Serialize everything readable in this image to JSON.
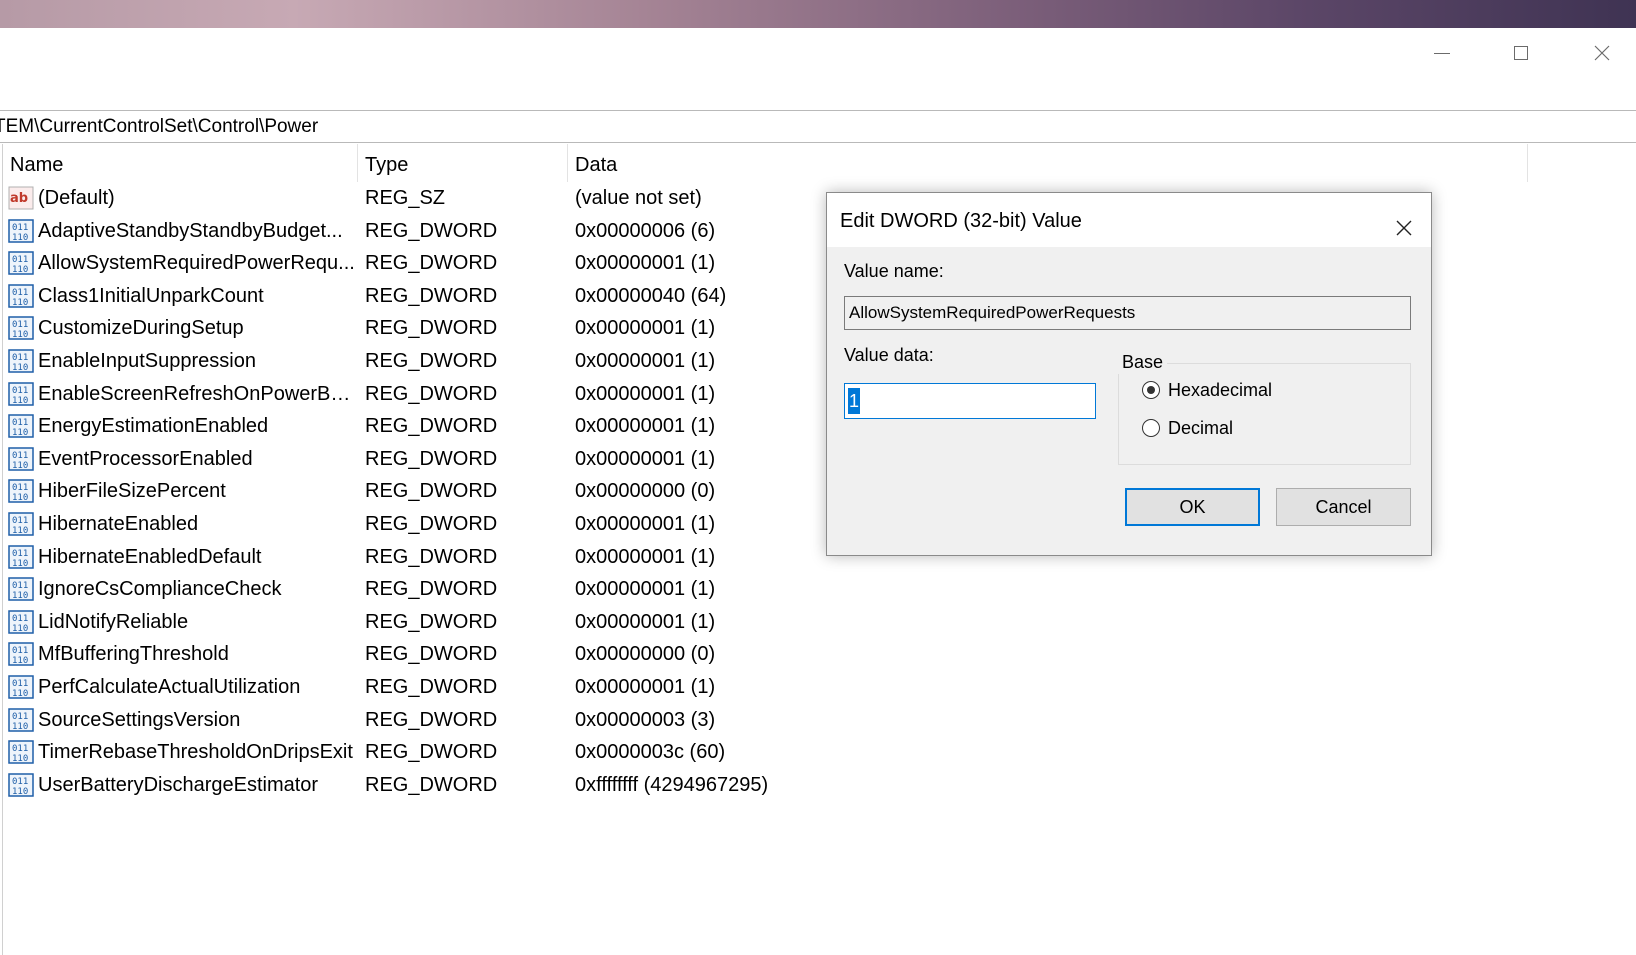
{
  "window": {
    "controls": [
      "minimize-icon",
      "maximize-icon",
      "close-icon"
    ]
  },
  "address": "TEM\\CurrentControlSet\\Control\\Power",
  "columns": {
    "name": "Name",
    "type": "Type",
    "data": "Data"
  },
  "rows": [
    {
      "icon": "string-value-icon",
      "name": "(Default)",
      "type": "REG_SZ",
      "data": "(value not set)"
    },
    {
      "icon": "binary-value-icon",
      "name": "AdaptiveStandbyStandbyBudget...",
      "type": "REG_DWORD",
      "data": "0x00000006 (6)"
    },
    {
      "icon": "binary-value-icon",
      "name": "AllowSystemRequiredPowerRequ...",
      "type": "REG_DWORD",
      "data": "0x00000001 (1)"
    },
    {
      "icon": "binary-value-icon",
      "name": "Class1InitialUnparkCount",
      "type": "REG_DWORD",
      "data": "0x00000040 (64)"
    },
    {
      "icon": "binary-value-icon",
      "name": "CustomizeDuringSetup",
      "type": "REG_DWORD",
      "data": "0x00000001 (1)"
    },
    {
      "icon": "binary-value-icon",
      "name": "EnableInputSuppression",
      "type": "REG_DWORD",
      "data": "0x00000001 (1)"
    },
    {
      "icon": "binary-value-icon",
      "name": "EnableScreenRefreshOnPowerBu...",
      "type": "REG_DWORD",
      "data": "0x00000001 (1)"
    },
    {
      "icon": "binary-value-icon",
      "name": "EnergyEstimationEnabled",
      "type": "REG_DWORD",
      "data": "0x00000001 (1)"
    },
    {
      "icon": "binary-value-icon",
      "name": "EventProcessorEnabled",
      "type": "REG_DWORD",
      "data": "0x00000001 (1)"
    },
    {
      "icon": "binary-value-icon",
      "name": "HiberFileSizePercent",
      "type": "REG_DWORD",
      "data": "0x00000000 (0)"
    },
    {
      "icon": "binary-value-icon",
      "name": "HibernateEnabled",
      "type": "REG_DWORD",
      "data": "0x00000001 (1)"
    },
    {
      "icon": "binary-value-icon",
      "name": "HibernateEnabledDefault",
      "type": "REG_DWORD",
      "data": "0x00000001 (1)"
    },
    {
      "icon": "binary-value-icon",
      "name": "IgnoreCsComplianceCheck",
      "type": "REG_DWORD",
      "data": "0x00000001 (1)"
    },
    {
      "icon": "binary-value-icon",
      "name": "LidNotifyReliable",
      "type": "REG_DWORD",
      "data": "0x00000001 (1)"
    },
    {
      "icon": "binary-value-icon",
      "name": "MfBufferingThreshold",
      "type": "REG_DWORD",
      "data": "0x00000000 (0)"
    },
    {
      "icon": "binary-value-icon",
      "name": "PerfCalculateActualUtilization",
      "type": "REG_DWORD",
      "data": "0x00000001 (1)"
    },
    {
      "icon": "binary-value-icon",
      "name": "SourceSettingsVersion",
      "type": "REG_DWORD",
      "data": "0x00000003 (3)"
    },
    {
      "icon": "binary-value-icon",
      "name": "TimerRebaseThresholdOnDripsExit",
      "type": "REG_DWORD",
      "data": "0x0000003c (60)"
    },
    {
      "icon": "binary-value-icon",
      "name": "UserBatteryDischargeEstimator",
      "type": "REG_DWORD",
      "data": "0xffffffff (4294967295)"
    }
  ],
  "dialog": {
    "title": "Edit DWORD (32-bit) Value",
    "value_name_label": "Value name:",
    "value_name": "AllowSystemRequiredPowerRequests",
    "value_data_label": "Value data:",
    "value_data": "1",
    "base_label": "Base",
    "base_options": [
      {
        "label": "Hexadecimal",
        "selected": true
      },
      {
        "label": "Decimal",
        "selected": false
      }
    ],
    "ok_label": "OK",
    "cancel_label": "Cancel"
  },
  "colors": {
    "accent": "#0078d7",
    "dialog_bg": "#f0f0f0",
    "string_icon": "#c0392b",
    "binary_icon": "#1f5fa8"
  }
}
